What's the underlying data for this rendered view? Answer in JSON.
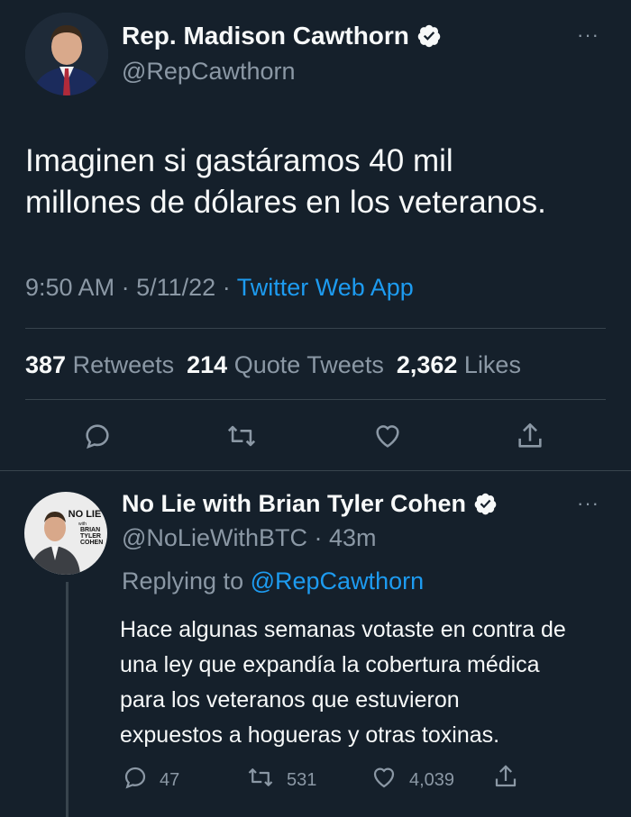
{
  "main_tweet": {
    "display_name": "Rep. Madison Cawthorn",
    "handle": "@RepCawthorn",
    "text_line1": "Imaginen si gastáramos 40 mil",
    "text_line2": "millones de dólares en los veteranos.",
    "time": "9:50 AM",
    "date": "5/11/22",
    "source": "Twitter Web App",
    "retweets_count": "387",
    "retweets_label": "Retweets",
    "quotes_count": "214",
    "quotes_label": "Quote Tweets",
    "likes_count": "2,362",
    "likes_label": "Likes",
    "more": "···"
  },
  "reply_tweet": {
    "display_name": "No Lie with Brian Tyler Cohen",
    "handle": "@NoLieWithBTC",
    "time_ago": "43m",
    "replying_prefix": "Replying to",
    "replying_to": "@RepCawthorn",
    "text_line1": "Hace algunas semanas votaste en contra de",
    "text_line2": "una ley que expandía la cobertura médica",
    "text_line3": "para los veteranos que estuvieron",
    "text_line4": "expuestos a hogueras y otras toxinas.",
    "reply_count": "47",
    "retweet_count": "531",
    "like_count": "4,039",
    "more": "···",
    "avatar_logo_line1": "NO LIE",
    "avatar_logo_line2": "with",
    "avatar_logo_line3": "BRIAN",
    "avatar_logo_line4": "TYLER",
    "avatar_logo_line5": "COHEN"
  },
  "colors": {
    "background": "#15202b",
    "text": "#f7f9f9",
    "secondary": "#8b98a5",
    "accent": "#1d9bf0",
    "divider": "#38444d"
  },
  "icons": [
    "verified-badge-icon",
    "reply-icon",
    "retweet-icon",
    "like-icon",
    "share-icon",
    "more-icon"
  ]
}
